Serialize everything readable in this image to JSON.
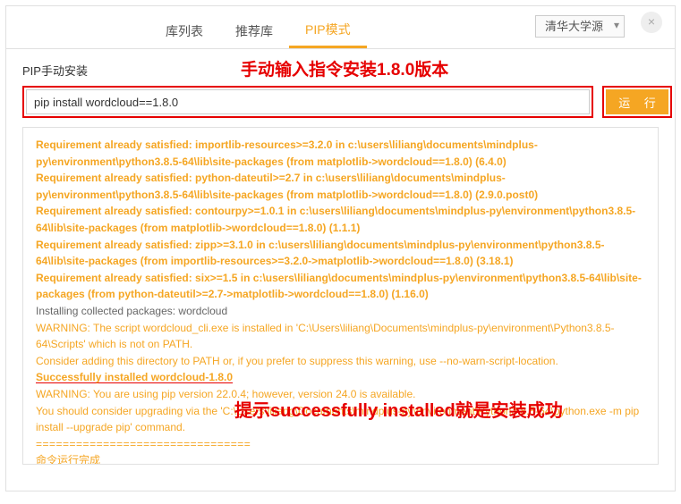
{
  "tabs": {
    "t1": "库列表",
    "t2": "推荐库",
    "t3": "PIP模式"
  },
  "source": {
    "selected": "清华大学源"
  },
  "close": "×",
  "section": {
    "title": "PIP手动安装",
    "annot1": "手动输入指令安装1.8.0版本",
    "input_value": "pip install wordcloud==1.8.0",
    "run_label": "运 行"
  },
  "annot2": "提示successfully installed就是安装成功",
  "out": {
    "l1": "Requirement already satisfied: importlib-resources>=3.2.0 in c:\\users\\liliang\\documents\\mindplus-py\\environment\\python3.8.5-64\\lib\\site-packages (from matplotlib->wordcloud==1.8.0) (6.4.0)",
    "l2": "Requirement already satisfied: python-dateutil>=2.7 in c:\\users\\liliang\\documents\\mindplus-py\\environment\\python3.8.5-64\\lib\\site-packages (from matplotlib->wordcloud==1.8.0) (2.9.0.post0)",
    "l3": "Requirement already satisfied: contourpy>=1.0.1 in c:\\users\\liliang\\documents\\mindplus-py\\environment\\python3.8.5-64\\lib\\site-packages (from matplotlib->wordcloud==1.8.0) (1.1.1)",
    "l4": "Requirement already satisfied: zipp>=3.1.0 in c:\\users\\liliang\\documents\\mindplus-py\\environment\\python3.8.5-64\\lib\\site-packages (from importlib-resources>=3.2.0->matplotlib->wordcloud==1.8.0) (3.18.1)",
    "l5": "Requirement already satisfied: six>=1.5 in c:\\users\\liliang\\documents\\mindplus-py\\environment\\python3.8.5-64\\lib\\site-packages (from python-dateutil>=2.7->matplotlib->wordcloud==1.8.0) (1.16.0)",
    "l6": "Installing collected packages: wordcloud",
    "l7": "  WARNING: The script wordcloud_cli.exe is installed in 'C:\\Users\\liliang\\Documents\\mindplus-py\\environment\\Python3.8.5-64\\Scripts' which is not on PATH.",
    "l8": "  Consider adding this directory to PATH or, if you prefer to suppress this warning, use --no-warn-script-location.",
    "l9": "Successfully installed wordcloud-1.8.0",
    "l10": "WARNING: You are using pip version 22.0.4; however, version 24.0 is available.",
    "l11": "You should consider upgrading via the 'C:\\Users\\liliang\\Documents\\mindplus-py\\environment\\Python3.8.5-64\\python.exe -m pip install --upgrade pip' command.",
    "sep": "================================",
    "done": "  命令运行完成"
  }
}
